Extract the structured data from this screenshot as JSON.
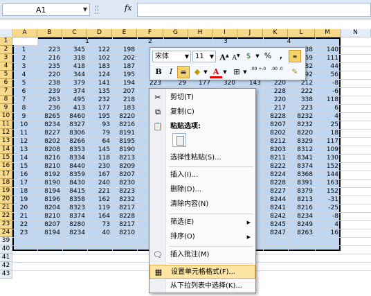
{
  "formula_bar": {
    "name_box": "A1",
    "fx": "fx",
    "formula": ""
  },
  "columns": [
    "A",
    "B",
    "C",
    "D",
    "E",
    "F",
    "G",
    "H",
    "I",
    "J",
    "K",
    "L",
    "M",
    "N"
  ],
  "row_numbers": [
    "1",
    "2",
    "3",
    "4",
    "5",
    "6",
    "7",
    "8",
    "9",
    "10",
    "11",
    "12",
    "13",
    "14",
    "15",
    "16",
    "17",
    "18",
    "19",
    "20",
    "21",
    "22",
    "23",
    "24",
    "39",
    "40",
    "41",
    "42",
    "43"
  ],
  "group_headers": [
    "1",
    "2",
    "3",
    "4"
  ],
  "rows": [
    {
      "n": "1",
      "B": "223",
      "C": "345",
      "D": "122",
      "E": "198",
      "L": "38",
      "M": "140"
    },
    {
      "n": "2",
      "B": "216",
      "C": "318",
      "D": "102",
      "E": "202",
      "L": "59",
      "M": "111"
    },
    {
      "n": "3",
      "B": "235",
      "C": "418",
      "D": "183",
      "E": "187",
      "L": "82",
      "M": "44"
    },
    {
      "n": "4",
      "B": "220",
      "C": "344",
      "D": "124",
      "E": "195",
      "L": "92",
      "M": "56"
    },
    {
      "n": "5",
      "B": "238",
      "C": "379",
      "D": "141",
      "E": "194",
      "F": "223",
      "G": "29",
      "H": "177",
      "I": "320",
      "J": "143",
      "K": "220",
      "L": "212",
      "M": "-8"
    },
    {
      "n": "6",
      "B": "239",
      "C": "374",
      "D": "135",
      "E": "207",
      "K": "228",
      "L": "222",
      "M": "-6"
    },
    {
      "n": "7",
      "B": "263",
      "C": "495",
      "D": "232",
      "E": "218",
      "K": "220",
      "L": "338",
      "M": "118"
    },
    {
      "n": "8",
      "B": "236",
      "C": "413",
      "D": "177",
      "E": "183",
      "K": "217",
      "L": "223",
      "M": "6"
    },
    {
      "n": "9",
      "B": "8265",
      "C": "8460",
      "D": "195",
      "E": "8220",
      "K": "8228",
      "L": "8232",
      "M": "4"
    },
    {
      "n": "10",
      "B": "8234",
      "C": "8327",
      "D": "93",
      "E": "8216",
      "K": "8207",
      "L": "8232",
      "M": "25"
    },
    {
      "n": "11",
      "B": "8227",
      "C": "8306",
      "D": "79",
      "E": "8191",
      "K": "8202",
      "L": "8220",
      "M": "18"
    },
    {
      "n": "12",
      "B": "8202",
      "C": "8266",
      "D": "64",
      "E": "8195",
      "K": "8212",
      "L": "8329",
      "M": "117"
    },
    {
      "n": "13",
      "B": "8208",
      "C": "8353",
      "D": "145",
      "E": "8190",
      "K": "8203",
      "L": "8312",
      "M": "109"
    },
    {
      "n": "14",
      "B": "8216",
      "C": "8334",
      "D": "118",
      "E": "8213",
      "K": "8211",
      "L": "8341",
      "M": "130"
    },
    {
      "n": "15",
      "B": "8210",
      "C": "8440",
      "D": "230",
      "E": "8209",
      "K": "8222",
      "L": "8374",
      "M": "152"
    },
    {
      "n": "16",
      "B": "8192",
      "C": "8359",
      "D": "167",
      "E": "8207",
      "K": "8224",
      "L": "8368",
      "M": "144"
    },
    {
      "n": "17",
      "B": "8190",
      "C": "8430",
      "D": "240",
      "E": "8230",
      "K": "8228",
      "L": "8391",
      "M": "163"
    },
    {
      "n": "18",
      "B": "8194",
      "C": "8415",
      "D": "221",
      "E": "8223",
      "K": "8227",
      "L": "8379",
      "M": "152"
    },
    {
      "n": "19",
      "B": "8196",
      "C": "8358",
      "D": "162",
      "E": "8232",
      "K": "8244",
      "L": "8213",
      "M": "-31"
    },
    {
      "n": "20",
      "B": "8204",
      "C": "8323",
      "D": "119",
      "E": "8217",
      "K": "8241",
      "L": "8216",
      "M": "-25"
    },
    {
      "n": "21",
      "B": "8210",
      "C": "8374",
      "D": "164",
      "E": "8228",
      "K": "8242",
      "L": "8234",
      "M": "-8"
    },
    {
      "n": "22",
      "B": "8207",
      "C": "8280",
      "D": "73",
      "E": "8217",
      "K": "8245",
      "L": "8249",
      "M": "4"
    },
    {
      "n": "23",
      "B": "8194",
      "C": "8234",
      "D": "40",
      "E": "8210",
      "K": "8247",
      "L": "8263",
      "M": "16"
    }
  ],
  "mini_toolbar": {
    "font_name": "宋体",
    "font_size": "11",
    "grow": "A",
    "shrink": "A",
    "currency": "$",
    "percent": "%",
    "comma": ",",
    "bold": "B",
    "italic": "I",
    "font_color": "A",
    "dec_inc": ".00 +.0",
    "dec_dec": ".00 .0"
  },
  "context_menu": {
    "cut": "剪切(T)",
    "copy": "复制(C)",
    "paste_options": "粘贴选项:",
    "paste_special": "选择性粘贴(S)...",
    "insert": "插入(I)...",
    "delete": "删除(D)...",
    "clear": "清除内容(N)",
    "filter": "筛选(E)",
    "sort": "排序(O)",
    "comment": "插入批注(M)",
    "format_cells": "设置单元格格式(F)...",
    "pick_list": "从下拉列表中选择(K)..."
  },
  "watermark": "Baidu 经验",
  "colors": {
    "selection": "#bfd6f0",
    "header_active": "#f8d98a",
    "highlight": "#fde5a5"
  }
}
